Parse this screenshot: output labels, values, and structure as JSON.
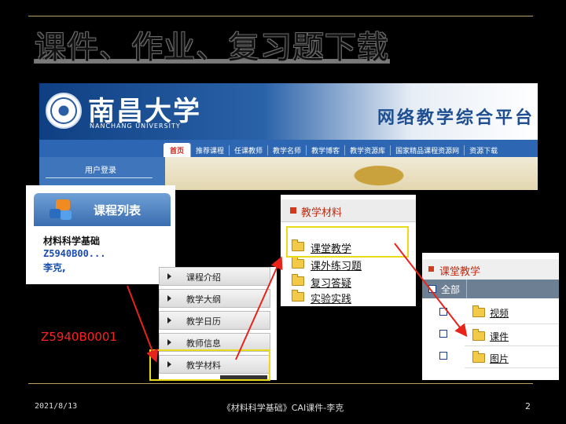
{
  "slide": {
    "title": "课件、作业、复习题下载",
    "code_caption": "Z5940B0001",
    "footer": {
      "date": "2021/8/13",
      "center": "《材料科学基础》CAI课件-李克",
      "page": "2"
    }
  },
  "portal": {
    "university_cn": "南昌大学",
    "university_en": "NANCHANG UNIVERSITY",
    "platform_title": "网络教学综合平台",
    "nav": [
      "首页",
      "推荐课程",
      "任课教师",
      "教学名师",
      "教学博客",
      "教学资源库",
      "国家精品课程资源网",
      "资源下载"
    ],
    "login_label": "用户登录"
  },
  "course_list": {
    "title": "课程列表",
    "course_name": "材料科学基础",
    "course_code": "Z5940B00...",
    "teacher": "李克,"
  },
  "menu": {
    "items": [
      "课程介绍",
      "教学大纲",
      "教学日历",
      "教师信息",
      "教学材料"
    ]
  },
  "materials": {
    "title": "教学材料",
    "items": [
      "课堂教学",
      "课外练习题",
      "复习答疑",
      "实验实践"
    ]
  },
  "classroom": {
    "title": "课堂教学",
    "select_all": "全部",
    "items": [
      "视频",
      "课件",
      "图片"
    ]
  },
  "colors": {
    "annotation_red": "#e8231c",
    "highlight_yellow": "#e8dc1a",
    "portal_blue": "#2d67b3"
  }
}
